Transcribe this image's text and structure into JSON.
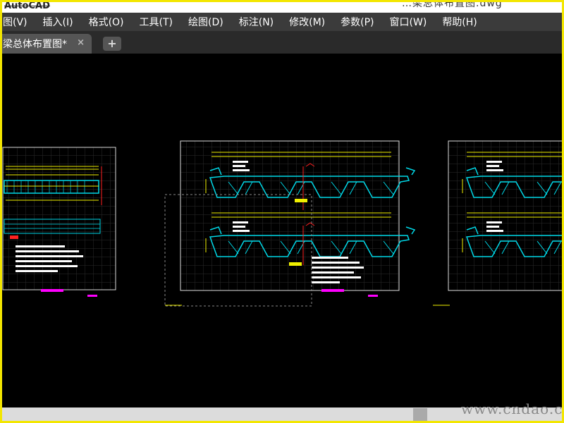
{
  "app": {
    "title_fragment": "AutoCAD",
    "document_title_fragment": "…梁总体布置图.dwg"
  },
  "menu": {
    "items": [
      "图(V)",
      "插入(I)",
      "格式(O)",
      "工具(T)",
      "绘图(D)",
      "标注(N)",
      "修改(M)",
      "参数(P)",
      "窗口(W)",
      "帮助(H)"
    ]
  },
  "tabs": {
    "active_label": "梁总体布置图*",
    "close_glyph": "×",
    "add_glyph": "+"
  },
  "watermark": {
    "text": "www.cndao.com"
  },
  "colors": {
    "frame": "#f3e600",
    "menubar": "#3b3b3b",
    "tabbar": "#2a2a2a",
    "canvas": "#000000",
    "sheet_border": "#dddddd",
    "grid": "#333333",
    "cad_cyan": "#00d9e8",
    "cad_yellow": "#f0f000",
    "cad_red": "#ff2020",
    "cad_magenta": "#ff00ff",
    "cad_white": "#ffffff"
  }
}
